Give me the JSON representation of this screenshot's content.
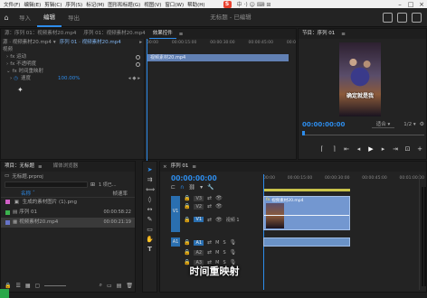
{
  "menu": {
    "items": [
      "文件(F)",
      "编辑(E)",
      "剪辑(C)",
      "序列(S)",
      "标记(M)",
      "图形和标题(G)",
      "视图(V)",
      "窗口(W)",
      "帮助(H)"
    ],
    "brand_badge": "S"
  },
  "header": {
    "tabs": [
      "导入",
      "编辑",
      "导出"
    ],
    "active_tab": "编辑",
    "doc_title": "无标题 - 已编辑"
  },
  "source_panel": {
    "tabs": [
      "源：序列 01：视频素材20.mp4",
      "序列 01：视频素材20.mp4",
      "效果控件"
    ],
    "active_tab": "效果控件",
    "source_label": "源 · 视频素材20.mp4",
    "sequence_label": "序列 01 · 视频素材20.mp4",
    "ruler": [
      "00:00",
      "00:00:15:00",
      "00:00:30:00",
      "00:00:45:00",
      "00:0"
    ],
    "clip_label": "视频素材20.mp4",
    "rows": [
      {
        "label": "视频",
        "indent": 0
      },
      {
        "label": "fx 运动",
        "indent": 1
      },
      {
        "label": "fx 不透明度",
        "indent": 1
      },
      {
        "label": "fx 时间重映射",
        "indent": 1
      },
      {
        "label": "速度",
        "indent": 2,
        "value": "100.00%"
      }
    ]
  },
  "program_panel": {
    "title": "节目：序列 01",
    "timecode": "00:00:00:00",
    "fit": "适合",
    "zoom": "1/2",
    "video_caption": "确定就是我"
  },
  "project_panel": {
    "tabs": [
      "项目：无标题",
      "媒体浏览器"
    ],
    "active_tab": "项目：无标题",
    "file_name": "无标题.prproj",
    "count": "1 项已...",
    "columns": [
      "名称",
      "帧速率"
    ],
    "items": [
      {
        "name": "生成的素材图片 (1).png",
        "rate": "",
        "color": "#d05fc6",
        "icon": "image-icon"
      },
      {
        "name": "序列 01",
        "rate": "00:00:58:22",
        "color": "#3cb44f",
        "icon": "sequence-icon"
      },
      {
        "name": "视频素材20.mp4",
        "rate": "00:00:21:19",
        "color": "#6674c8",
        "icon": "video-icon"
      }
    ]
  },
  "timeline": {
    "title": "序列 01",
    "timecode": "00:00:00:00",
    "ruler": [
      "00:00",
      "00:00:15:00",
      "00:00:30:00",
      "00:00:45:00",
      "00:01:00:00"
    ],
    "tracks_video": [
      "V3",
      "V2",
      "V1"
    ],
    "tracks_audio": [
      "A1",
      "A2",
      "A3"
    ],
    "source_patch_video": "V1",
    "source_patch_audio": "A1",
    "clip_label": "视频素材20.mp4",
    "track_name": "视频 1",
    "subtitle": "时间重映射"
  },
  "colors": {
    "accent": "#2d8ceb",
    "clip_video": "#7397d0",
    "clip_audio": "#6a92c6",
    "timecode": "#2d8ceb"
  }
}
